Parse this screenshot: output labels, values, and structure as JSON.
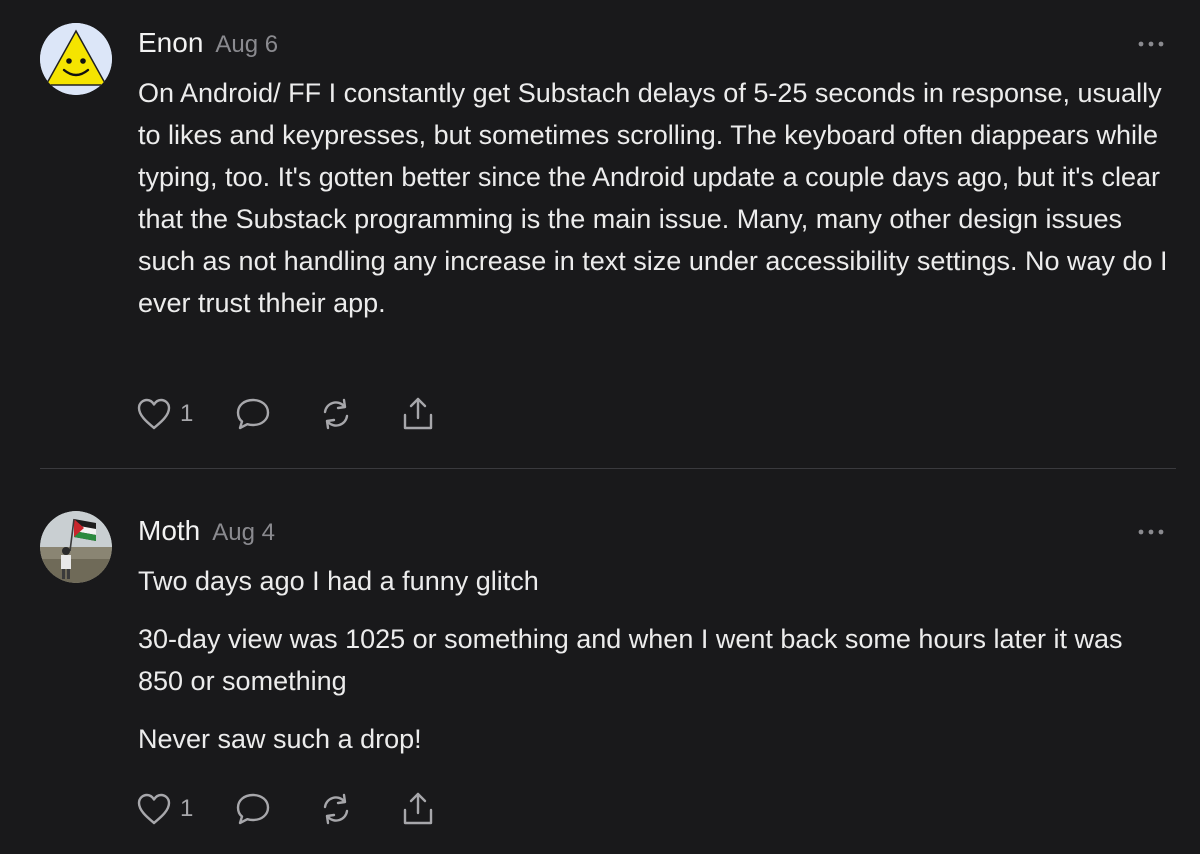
{
  "comments": [
    {
      "author": "Enon",
      "date": "Aug 6",
      "body": [
        "On Android/ FF I constantly get Substach delays of 5-25 seconds in response, usually to likes and keypresses, but sometimes scrolling. The keyboard often diappears while typing, too. It's gotten better since the Android update a couple days ago, but it's clear that the Substack programming is the main issue. Many, many other design issues such as not handling any increase in text size under accessibility settings. No way do I ever trust thheir app."
      ],
      "likes": "1",
      "avatar_icon": "smiley-triangle-avatar"
    },
    {
      "author": "Moth",
      "date": "Aug 4",
      "body": [
        "Two days ago I had a funny glitch",
        "30-day view was 1025 or something and when I went back some hours later it was 850 or something",
        "Never saw such a drop!"
      ],
      "likes": "1",
      "avatar_icon": "photo-avatar-person-with-flag"
    }
  ],
  "icons": {
    "like": "heart-icon",
    "reply": "speech-bubble-icon",
    "restack": "restack-icon",
    "share": "share-icon",
    "more": "more-dots-icon"
  },
  "colors": {
    "background": "#19191b",
    "text": "#ececec",
    "muted": "#8a8a8f",
    "icon": "#a7a7ab",
    "divider": "#3a3a3e"
  }
}
